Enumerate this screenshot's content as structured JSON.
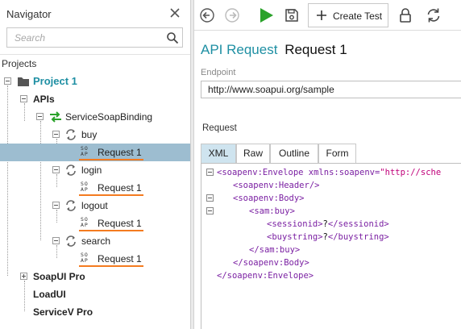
{
  "navigator": {
    "title": "Navigator",
    "search_placeholder": "Search",
    "projects_label": "Projects",
    "tree": {
      "project": "Project 1",
      "apis": "APIs",
      "binding": "ServiceSoapBinding",
      "operations": [
        {
          "name": "buy",
          "request": "Request 1",
          "selected": true
        },
        {
          "name": "login",
          "request": "Request 1",
          "selected": false
        },
        {
          "name": "logout",
          "request": "Request 1",
          "selected": false
        },
        {
          "name": "search",
          "request": "Request 1",
          "selected": false
        }
      ],
      "soapui_pro": "SoapUI Pro",
      "loadui": "LoadUI",
      "servicev_pro": "ServiceV Pro"
    },
    "soap_icon_text": "SOAP"
  },
  "toolbar": {
    "create_test_label": "Create Test"
  },
  "main": {
    "title_type": "API Request",
    "title_name": "Request 1",
    "endpoint_label": "Endpoint",
    "endpoint_value": "http://www.soapui.org/sample",
    "request_label": "Request",
    "tabs": [
      "XML",
      "Raw",
      "Outline",
      "Form"
    ],
    "active_tab": "XML"
  },
  "xml": {
    "l1_tag": "<soapenv:Envelope",
    "l1_attr": " xmlns:soapenv=",
    "l1_val": "\"http://sche",
    "l2": "<soapenv:Header/>",
    "l3": "<soapenv:Body>",
    "l4": "<sam:buy>",
    "l5_open": "<sessionid>",
    "l5_text": "?",
    "l5_close": "</sessionid>",
    "l6_open": "<buystring>",
    "l6_text": "?",
    "l6_close": "</buystring>",
    "l7": "</sam:buy>",
    "l8": "</soapenv:Body>",
    "l9": "</soapenv:Envelope>"
  },
  "colors": {
    "accent": "#1e8fa3",
    "selected_row": "#9dbdd0",
    "underline": "#f47b20",
    "run_green": "#2aa22a",
    "xml_tag": "#7a1fa2",
    "xml_value": "#c0007a"
  },
  "icons": {
    "close": "close-icon",
    "search": "search-icon",
    "back": "back-arrow-icon",
    "forward": "forward-arrow-icon",
    "run": "play-icon",
    "save": "save-icon",
    "add": "plus-icon",
    "lock": "lock-icon",
    "refresh": "refresh-icon"
  }
}
